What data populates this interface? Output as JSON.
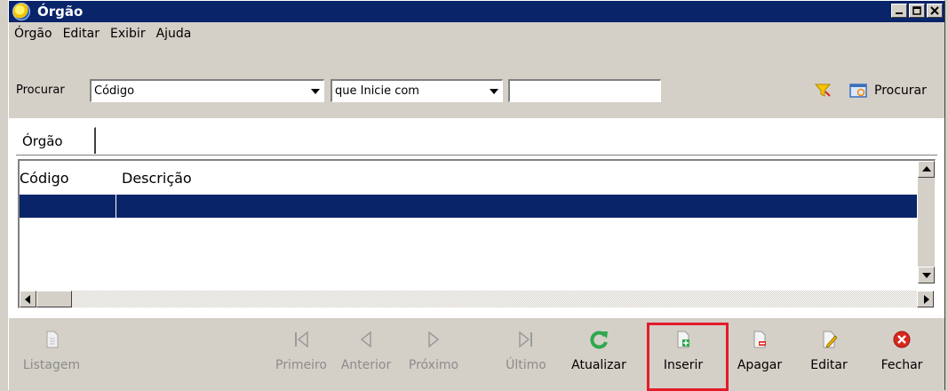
{
  "window": {
    "title": "Órgão",
    "window_buttons": [
      "minimize-icon",
      "restore-icon",
      "close-icon"
    ]
  },
  "menu": [
    {
      "label": "Órgão"
    },
    {
      "label": "Editar"
    },
    {
      "label": "Exibir"
    },
    {
      "label": "Ajuda"
    }
  ],
  "search": {
    "label": "Procurar",
    "field_value": "Código",
    "condition_value": "que Inicie com",
    "text_value": "",
    "search_button_label": "Procurar"
  },
  "tabs": [
    {
      "label": "Órgão"
    }
  ],
  "grid": {
    "columns": [
      "Código",
      "Descrição"
    ],
    "rows": [
      {
        "codigo": "",
        "descricao": "",
        "selected": true
      }
    ]
  },
  "toolbar": [
    {
      "label": "Listagem",
      "icon": "document-icon",
      "enabled": false
    },
    {
      "label": "Primeiro",
      "icon": "first-icon",
      "enabled": false
    },
    {
      "label": "Anterior",
      "icon": "previous-icon",
      "enabled": false
    },
    {
      "label": "Próximo",
      "icon": "next-icon",
      "enabled": false
    },
    {
      "label": "Último",
      "icon": "last-icon",
      "enabled": false
    },
    {
      "label": "Atualizar",
      "icon": "refresh-icon",
      "enabled": true
    },
    {
      "label": "Inserir",
      "icon": "insert-icon",
      "enabled": true,
      "highlighted": true
    },
    {
      "label": "Apagar",
      "icon": "delete-icon",
      "enabled": true
    },
    {
      "label": "Editar",
      "icon": "edit-icon",
      "enabled": true
    },
    {
      "label": "Fechar",
      "icon": "close-icon",
      "enabled": true
    }
  ],
  "colors": {
    "title_bar": "#0a246a",
    "selection": "#0a246a",
    "highlight_box": "#e21b2a",
    "refresh_green": "#2fa84f",
    "close_red": "#d9281e"
  }
}
